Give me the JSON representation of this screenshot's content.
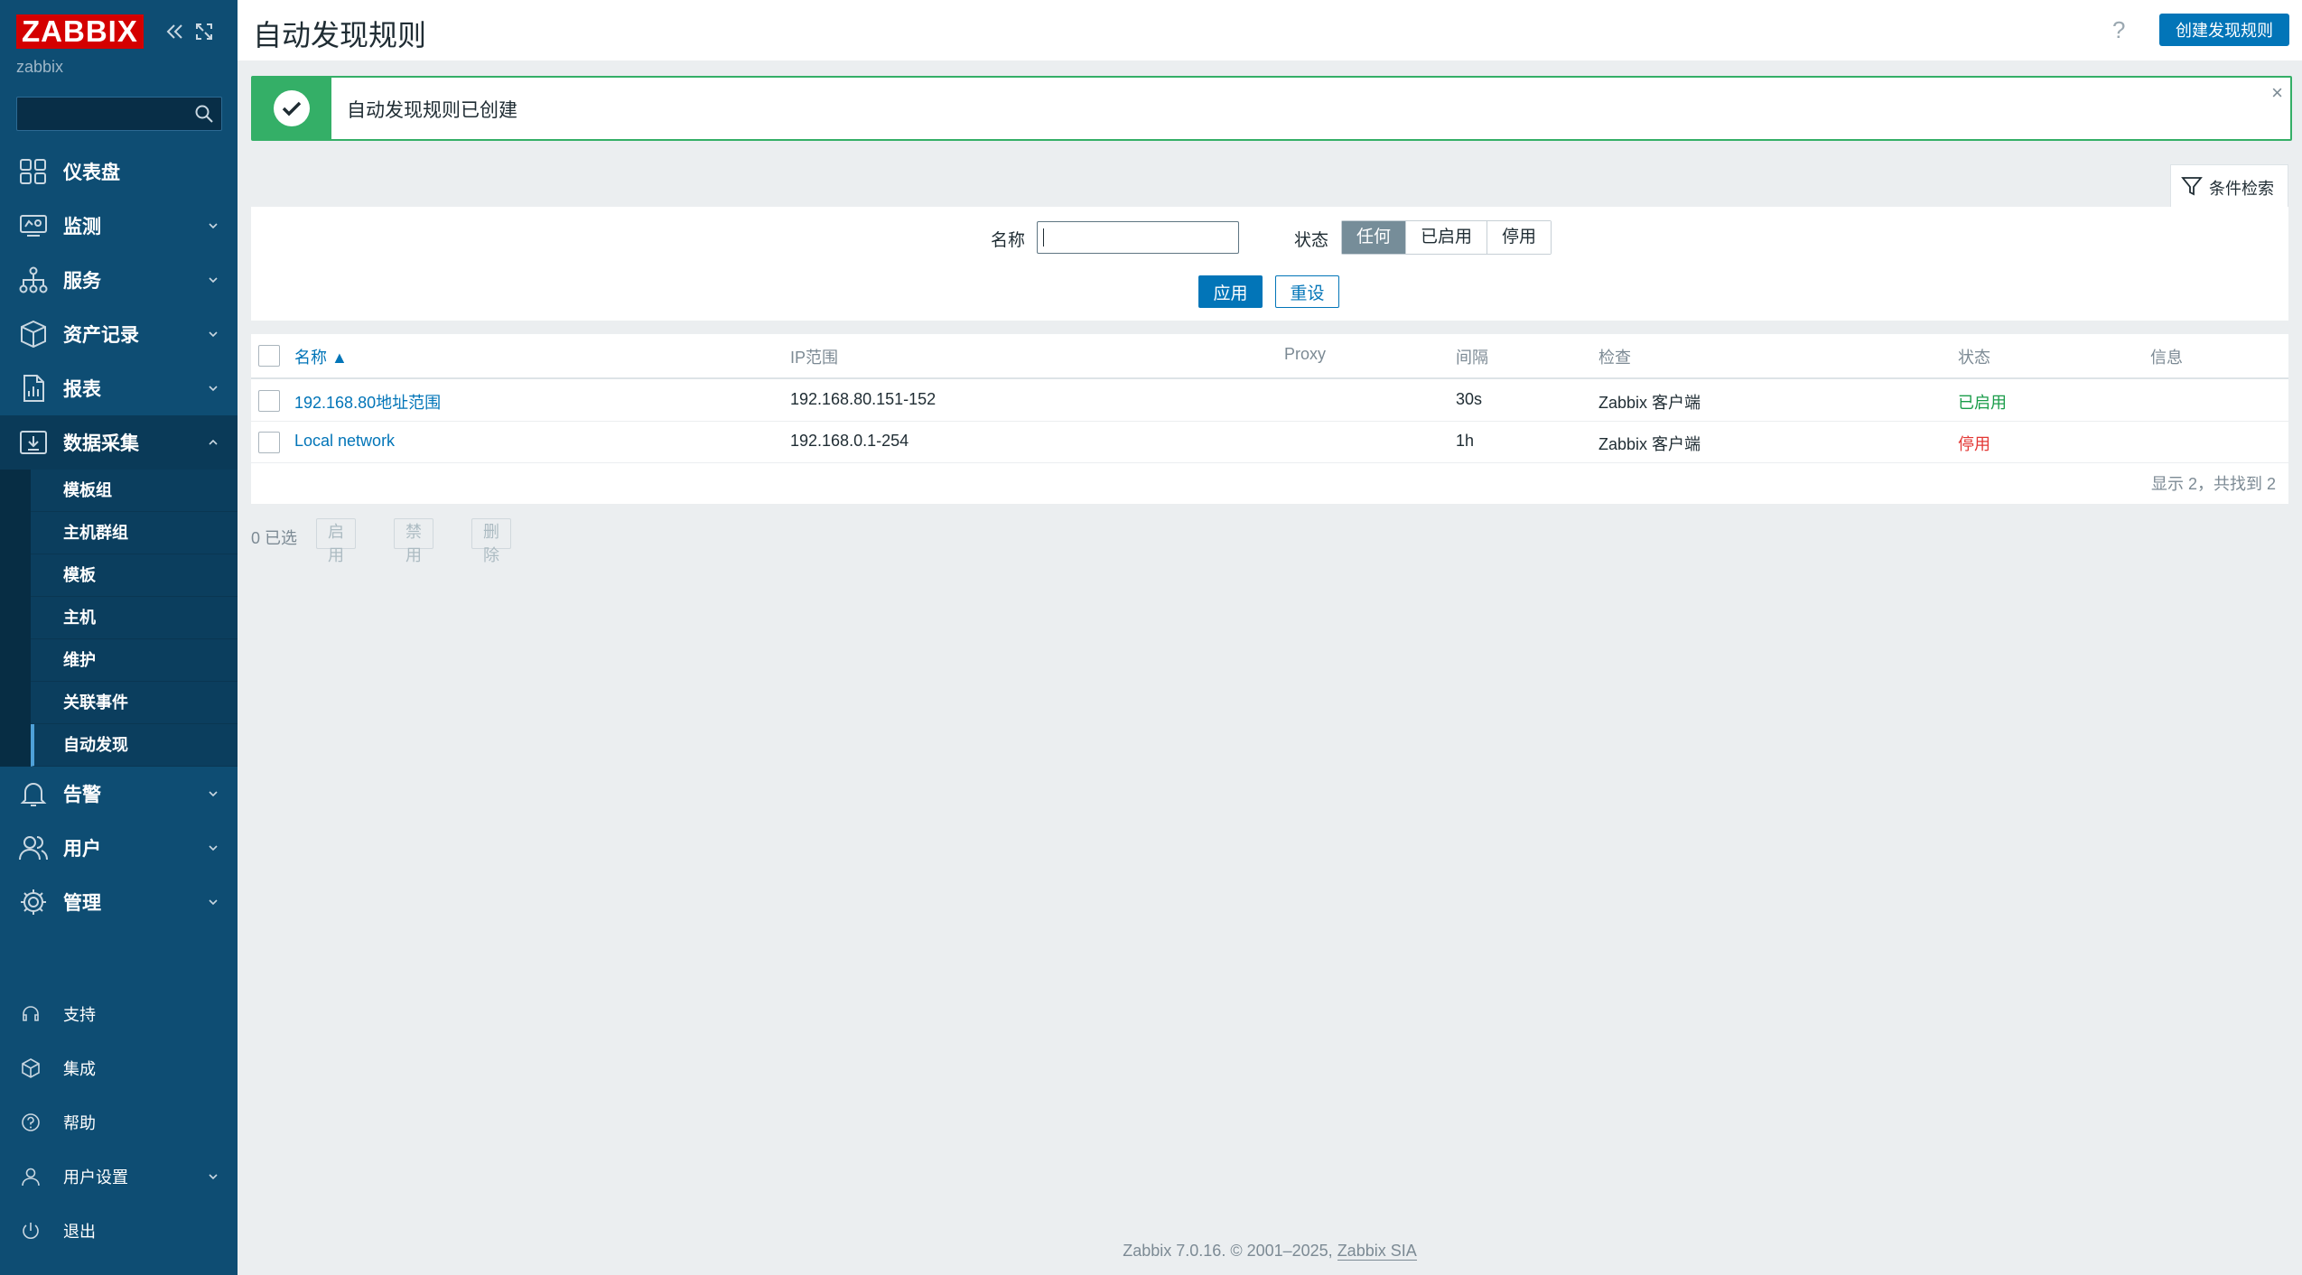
{
  "sidebar": {
    "logo": "ZABBIX",
    "server_name": "zabbix",
    "search_placeholder": "",
    "menu": [
      {
        "label": "仪表盘",
        "icon": "dashboard-icon"
      },
      {
        "label": "监测",
        "icon": "monitoring-icon"
      },
      {
        "label": "服务",
        "icon": "services-icon"
      },
      {
        "label": "资产记录",
        "icon": "inventory-icon"
      },
      {
        "label": "报表",
        "icon": "reports-icon"
      },
      {
        "label": "数据采集",
        "icon": "data-collection-icon"
      }
    ],
    "submenu": [
      "模板组",
      "主机群组",
      "模板",
      "主机",
      "维护",
      "关联事件",
      "自动发现"
    ],
    "menu_after": [
      {
        "label": "告警",
        "icon": "bell-icon"
      },
      {
        "label": "用户",
        "icon": "users-icon"
      },
      {
        "label": "管理",
        "icon": "gear-icon"
      }
    ],
    "bottom": [
      {
        "label": "支持",
        "icon": "headset-icon"
      },
      {
        "label": "集成",
        "icon": "integrations-icon"
      },
      {
        "label": "帮助",
        "icon": "help-icon"
      },
      {
        "label": "用户设置",
        "icon": "user-icon"
      },
      {
        "label": "退出",
        "icon": "power-icon"
      }
    ]
  },
  "header": {
    "title": "自动发现规则",
    "help": "?",
    "create_label": "创建发现规则"
  },
  "message": {
    "text": "自动发现规则已创建",
    "close": "×"
  },
  "filter": {
    "tab_label": "条件检索",
    "name_label": "名称",
    "name_value": "",
    "status_label": "状态",
    "status_options": [
      "任何",
      "已启用",
      "停用"
    ],
    "status_selected": "任何",
    "apply_label": "应用",
    "reset_label": "重设"
  },
  "table": {
    "headers": {
      "name": "名称 ▲",
      "ip_range": "IP范围",
      "proxy": "Proxy",
      "interval": "间隔",
      "checks": "检查",
      "status": "状态",
      "info": "信息"
    },
    "rows": [
      {
        "name": "192.168.80地址范围",
        "ip_range": "192.168.80.151-152",
        "proxy": "",
        "interval": "30s",
        "checks": "Zabbix 客户端",
        "status": "已启用"
      },
      {
        "name": "Local network",
        "ip_range": "192.168.0.1-254",
        "proxy": "",
        "interval": "1h",
        "checks": "Zabbix 客户端",
        "status": "停用"
      }
    ],
    "footer": "显示 2，共找到 2"
  },
  "mass_actions": {
    "selected": "0 已选",
    "enable": "启用",
    "disable": "禁用",
    "delete": "删除"
  },
  "footer": {
    "text": "Zabbix 7.0.16. © 2001–2025, ",
    "link": "Zabbix SIA"
  },
  "colors": {
    "sidebar": "#0e4d73",
    "accent": "#0275b8",
    "success": "#34af67",
    "enabled": "#1a9c4a",
    "disabled": "#e33734"
  }
}
